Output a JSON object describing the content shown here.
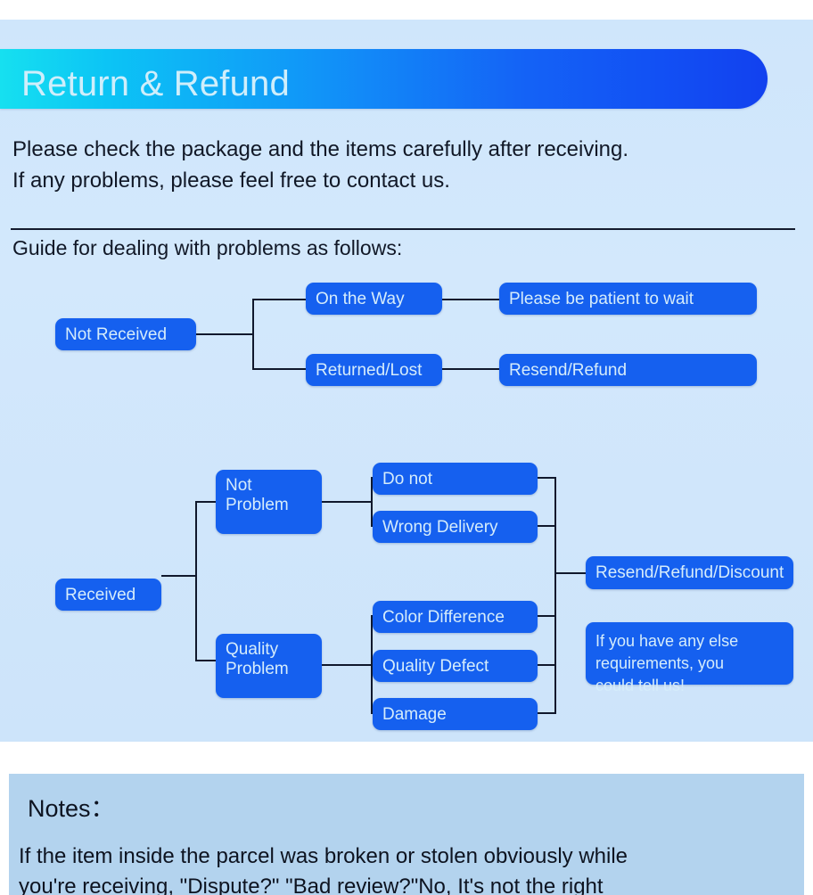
{
  "header": {
    "title": "Return & Refund",
    "gradient_from": "#16e0f0",
    "gradient_to": "#1241ef",
    "title_color": "#cfeefb"
  },
  "intro": {
    "line1": "Please check the package and the items carefully after receiving.",
    "line2": "If any problems, please feel free to contact us."
  },
  "guide_heading": "Guide for dealing with problems as follows:",
  "flow_not_received": {
    "root": "Not Received",
    "branches": [
      {
        "cause": "On the Way",
        "action": "Please be patient to wait"
      },
      {
        "cause": "Returned/Lost",
        "action": "Resend/Refund"
      }
    ]
  },
  "flow_received": {
    "root": "Received",
    "categories": [
      {
        "label": "Not\nProblem",
        "reasons": [
          "Do not",
          "Wrong Delivery"
        ]
      },
      {
        "label": "Quality\nProblem",
        "reasons": [
          "Color Difference",
          "Quality Defect",
          "Damage"
        ]
      }
    ],
    "outcomes": [
      "Resend/Refund/Discount",
      "If you have any else\nrequirements, you\ncould tell us!"
    ]
  },
  "notes": {
    "title": "Notes：",
    "line1": "If the item inside the parcel was broken or stolen obviously while",
    "line2": "you're receiving, \"Dispute?\" \"Bad review?\"No, It's not the right"
  },
  "colors": {
    "card_background": "#d2e7fb",
    "node_fill": "#1560ef",
    "node_text": "#d5ecfb",
    "line": "#10182c",
    "notes_background": "#b3d3ee",
    "body_text": "#111827"
  }
}
